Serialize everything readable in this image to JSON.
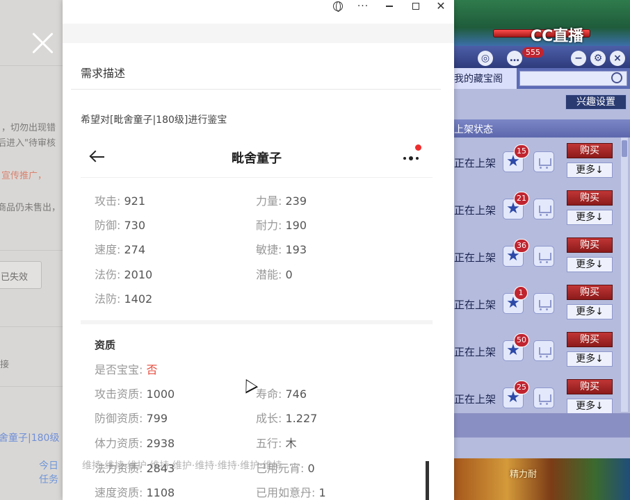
{
  "left_page": {
    "line1": "，切勿出现错",
    "line2": "后进入\"待审核",
    "line3": "宣传推广，",
    "line4": "商品仍未售出，",
    "expired_button": "已失效",
    "link_label": "接",
    "item_ref": "舍童子|180级",
    "task_label": "今日任务"
  },
  "modal": {
    "section_title": "需求描述",
    "request_text": "希望对[毗舍童子|180级]进行鉴宝",
    "phone": {
      "title": "毗舍童子",
      "stats": [
        {
          "label": "攻击:",
          "value": "921"
        },
        {
          "label": "力量:",
          "value": "239"
        },
        {
          "label": "防御:",
          "value": "730"
        },
        {
          "label": "耐力:",
          "value": "190"
        },
        {
          "label": "速度:",
          "value": "274"
        },
        {
          "label": "敏捷:",
          "value": "193"
        },
        {
          "label": "法伤:",
          "value": "2010"
        },
        {
          "label": "潜能:",
          "value": "0"
        },
        {
          "label": "法防:",
          "value": "1402"
        }
      ],
      "quality_title": "资质",
      "baby": {
        "label": "是否宝宝:",
        "value": "否"
      },
      "quality": [
        {
          "label": "攻击资质:",
          "value": "1000"
        },
        {
          "label": "寿命:",
          "value": "746"
        },
        {
          "label": "防御资质:",
          "value": "799"
        },
        {
          "label": "成长:",
          "value": "1.227"
        },
        {
          "label": "体力资质:",
          "value": "2938"
        },
        {
          "label": "五行:",
          "value": "木"
        },
        {
          "label": "法力资质:",
          "value": "2843"
        },
        {
          "label": "已用元宵:",
          "value": "0"
        },
        {
          "label": "速度资质:",
          "value": "1108"
        },
        {
          "label": "已用如意丹:",
          "value": "1"
        }
      ]
    }
  },
  "game": {
    "logo": "CC直播",
    "badge": "555",
    "tab_label": "我的藏宝阁",
    "interest_button": "兴趣设置",
    "status_header": "上架状态",
    "rows": [
      {
        "status": "正在上架",
        "count": "15",
        "buy": "购买",
        "more": "更多↓"
      },
      {
        "status": "正在上架",
        "count": "21",
        "buy": "购买",
        "more": "更多↓"
      },
      {
        "status": "正在上架",
        "count": "36",
        "buy": "购买",
        "more": "更多↓"
      },
      {
        "status": "正在上架",
        "count": "1",
        "buy": "购买",
        "more": "更多↓"
      },
      {
        "status": "正在上架",
        "count": "50",
        "buy": "购买",
        "more": "更多↓"
      },
      {
        "status": "正在上架",
        "count": "25",
        "buy": "购买",
        "more": "更多↓"
      }
    ],
    "scene_text": "精力耐"
  },
  "danmaku": "维持·维持·维护·维持·维护·维持·维持·维护·维持"
}
